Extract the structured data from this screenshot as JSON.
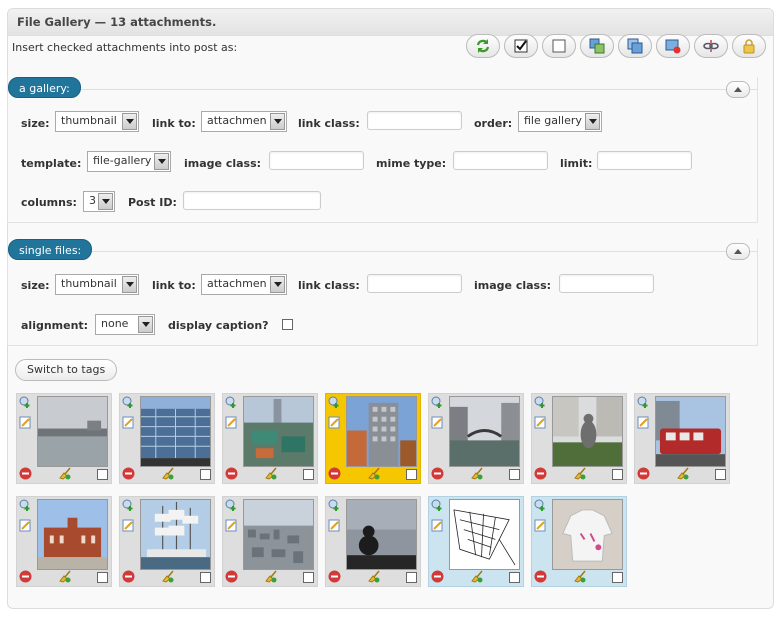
{
  "header": {
    "title": "File Gallery — 13 attachments."
  },
  "intro_text": "Insert checked attachments into post as:",
  "toolbar": {
    "buttons": [
      {
        "name": "refresh-icon"
      },
      {
        "name": "check-all-icon"
      },
      {
        "name": "uncheck-all-icon"
      },
      {
        "name": "copy-icon"
      },
      {
        "name": "duplicate-icon"
      },
      {
        "name": "delete-image-icon"
      },
      {
        "name": "unlink-icon"
      },
      {
        "name": "lock-icon"
      }
    ]
  },
  "gallery_section": {
    "title": "a gallery:",
    "size_label": "size:",
    "size_value": "thumbnail",
    "link_to_label": "link to:",
    "link_to_value": "attachmen",
    "link_class_label": "link class:",
    "link_class_value": "",
    "order_label": "order:",
    "order_value": "file gallery",
    "template_label": "template:",
    "template_value": "file-gallery",
    "image_class_label": "image class:",
    "image_class_value": "",
    "mime_type_label": "mime type:",
    "mime_type_value": "",
    "limit_label": "limit:",
    "limit_value": "",
    "columns_label": "columns:",
    "columns_value": "3",
    "post_id_label": "Post ID:",
    "post_id_value": ""
  },
  "single_section": {
    "title": "single files:",
    "size_label": "size:",
    "size_value": "thumbnail",
    "link_to_label": "link to:",
    "link_to_value": "attachmen",
    "link_class_label": "link class:",
    "link_class_value": "",
    "image_class_label": "image class:",
    "image_class_value": "",
    "alignment_label": "alignment:",
    "alignment_value": "none",
    "display_caption_label": "display caption?"
  },
  "switch_button": "Switch to tags",
  "attachments": [
    {
      "subject": "river-cloudy",
      "state": "normal"
    },
    {
      "subject": "glass-office-building",
      "state": "normal"
    },
    {
      "subject": "harbor-rooftop",
      "state": "normal"
    },
    {
      "subject": "skyscraper",
      "state": "selected"
    },
    {
      "subject": "canal-bridge",
      "state": "normal"
    },
    {
      "subject": "statue-plaza",
      "state": "normal"
    },
    {
      "subject": "red-tram",
      "state": "normal"
    },
    {
      "subject": "red-brick-warehouse",
      "state": "normal"
    },
    {
      "subject": "tall-ship",
      "state": "normal"
    },
    {
      "subject": "city-aerial",
      "state": "normal"
    },
    {
      "subject": "silhouette-dusk",
      "state": "normal"
    },
    {
      "subject": "map-sketch",
      "state": "document"
    },
    {
      "subject": "white-hoodie",
      "state": "document"
    }
  ],
  "colors": {
    "accent": "#21759b",
    "selected": "#f6c700",
    "document": "#cce4ef"
  }
}
